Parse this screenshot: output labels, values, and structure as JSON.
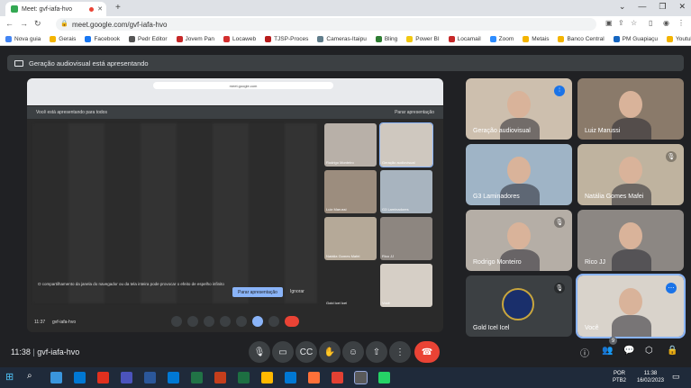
{
  "browser": {
    "tab_title": "Meet: gvf-iafa-hvo",
    "new_tab": "+",
    "url": "meet.google.com/gvf-iafa-hvo",
    "bookmarks": [
      {
        "label": "Nova guia",
        "color": "#4285f4"
      },
      {
        "label": "Gerais",
        "color": "#f4b400"
      },
      {
        "label": "Facebook",
        "color": "#1877f2"
      },
      {
        "label": "Pedr Editor",
        "color": "#555555"
      },
      {
        "label": "Jovem Pan",
        "color": "#c62828"
      },
      {
        "label": "Locaweb",
        "color": "#d32f2f"
      },
      {
        "label": "TJSP-Proces",
        "color": "#b71c1c"
      },
      {
        "label": "Cameras-Itaipu",
        "color": "#607d8b"
      },
      {
        "label": "Bling",
        "color": "#2e7d32"
      },
      {
        "label": "Power BI",
        "color": "#f2c811"
      },
      {
        "label": "Locamail",
        "color": "#c62828"
      },
      {
        "label": "Zoom",
        "color": "#2d8cff"
      },
      {
        "label": "Metais",
        "color": "#f4b400"
      },
      {
        "label": "Banco Central",
        "color": "#f4b400"
      },
      {
        "label": "PM Guapiaçu",
        "color": "#1565c0"
      },
      {
        "label": "Youtube",
        "color": "#f4b400"
      }
    ]
  },
  "meet": {
    "presenting_banner": "Geração audiovisual está apresentando",
    "inner_url": "meet.google.com",
    "inner_note_left": "Você está apresentando para todos",
    "inner_note_right": "Parar apresentação",
    "inner_dialog": "O compartilhamento da janela do navegador ou da tela inteira pode provocar o efeito de espelho infinito",
    "inner_btn_primary": "Parar apresentação",
    "inner_btn_secondary": "Ignorar",
    "inner_time": "11:37",
    "inner_code": "gvf-iafa-hvo",
    "mini_tiles": [
      {
        "name": "Rodrigo Monteiro",
        "bg": "#b8b0a8"
      },
      {
        "name": "Geração audiovisual",
        "bg": "#cfc8bf"
      },
      {
        "name": "Luiz Marussi",
        "bg": "#9c8d7e"
      },
      {
        "name": "G3 Laminadores",
        "bg": "#a8b4bf"
      },
      {
        "name": "Natália Gomes Mafei",
        "bg": "#b5a998"
      },
      {
        "name": "Rico JJ",
        "bg": "#8d8680"
      },
      {
        "name": "Gold Icel Icel",
        "bg": "#2a2a2a"
      },
      {
        "name": "Você",
        "bg": "#d6cfc6"
      }
    ],
    "participants": [
      {
        "name": "Geração audiovisual",
        "bg": "#cdbfae",
        "mic": "speaking"
      },
      {
        "name": "Luiz Marussi",
        "bg": "#8a7a6a",
        "mic": "none"
      },
      {
        "name": "G3 Laminadores",
        "bg": "#9fb4c6",
        "mic": "none"
      },
      {
        "name": "Natália Gomes Mafei",
        "bg": "#bfb39f",
        "mic": "muted"
      },
      {
        "name": "Rodrigo Monteiro",
        "bg": "#b5aea6",
        "mic": "muted"
      },
      {
        "name": "Rico JJ",
        "bg": "#8c8783",
        "mic": "none"
      },
      {
        "name": "Gold Icel Icel",
        "bg": "#3c4043",
        "mic": "muted"
      },
      {
        "name": "Você",
        "bg": "#d9d3cb",
        "mic": "more"
      }
    ],
    "time": "11:38",
    "code": "gvf-iafa-hvo",
    "people_count": "9"
  },
  "taskbar": {
    "lang": "POR",
    "lang2": "PTB2",
    "time": "11:38",
    "date": "16/02/2023"
  },
  "colors": {
    "accent": "#8ab4f8",
    "end_call": "#ea4335",
    "meet_bg": "#202124"
  }
}
